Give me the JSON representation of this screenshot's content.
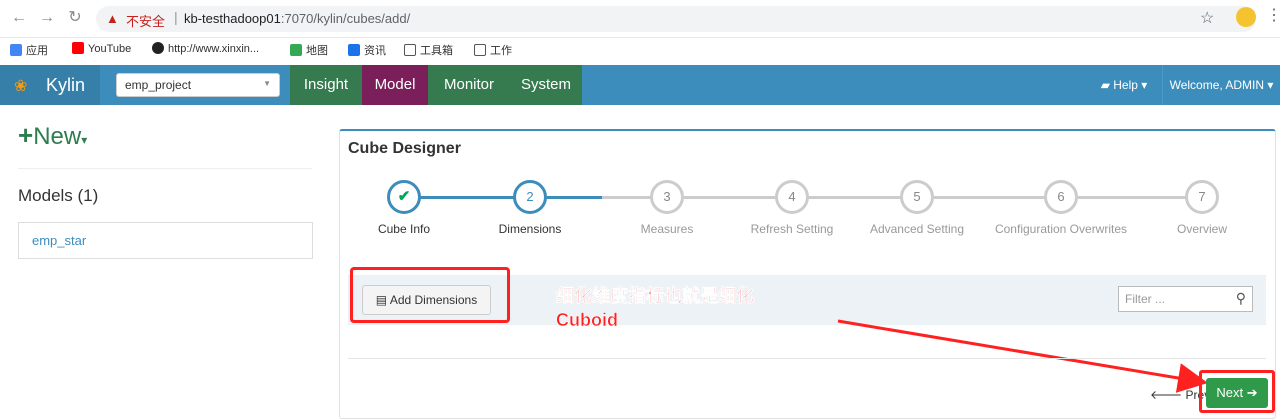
{
  "browser": {
    "insecure_label": "不安全",
    "url_host": "kb-testhadoop01",
    "url_rest": ":7070/kylin/cubes/add/",
    "bookmarks": [
      "应用",
      "YouTube",
      "http://www.xinxin...",
      "地图",
      "资讯",
      "工具箱",
      "工作"
    ]
  },
  "topnav": {
    "brand": "Kylin",
    "project": "emp_project",
    "tabs": [
      "Insight",
      "Model",
      "Monitor",
      "System"
    ],
    "help": "Help",
    "welcome": "Welcome, ADMIN"
  },
  "sidebar": {
    "new_label": "New",
    "models_title": "Models (1)",
    "models": [
      "emp_star"
    ]
  },
  "designer": {
    "title": "Cube Designer",
    "steps": [
      {
        "num": "✔",
        "label": "Cube Info",
        "state": "done"
      },
      {
        "num": "2",
        "label": "Dimensions",
        "state": "active"
      },
      {
        "num": "3",
        "label": "Measures",
        "state": "todo"
      },
      {
        "num": "4",
        "label": "Refresh Setting",
        "state": "todo"
      },
      {
        "num": "5",
        "label": "Advanced Setting",
        "state": "todo"
      },
      {
        "num": "6",
        "label": "Configuration Overwrites",
        "state": "todo"
      },
      {
        "num": "7",
        "label": "Overview",
        "state": "todo"
      }
    ],
    "add_dimensions": "Add Dimensions",
    "filter_placeholder": "Filter ...",
    "prev": "Prev",
    "next": "Next"
  },
  "annotation": {
    "line1": "细化维度指标也就是细化",
    "line2": "Cuboid"
  },
  "colors": {
    "nav_blue": "#3c8dbc",
    "model_tab": "#7a1f5a",
    "green_tab": "#367a4f",
    "next_green": "#2e9a4a",
    "annotation_red": "#ff2020"
  }
}
